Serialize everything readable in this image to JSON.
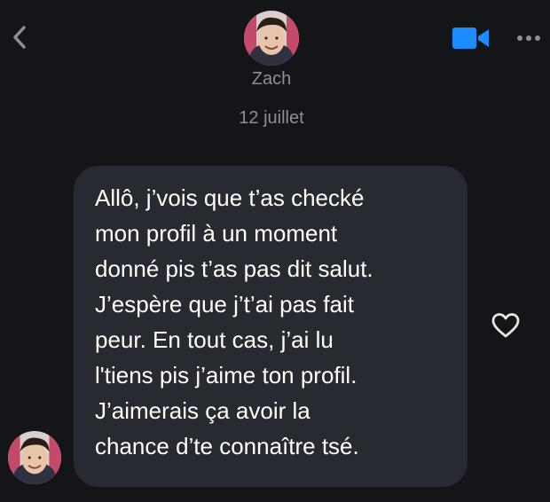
{
  "header": {
    "back_icon": "chevron-left-icon",
    "contact_name": "Zach",
    "video_icon": "video-camera-icon",
    "more_icon": "more-horizontal-icon",
    "accent_color": "#1a8cff"
  },
  "thread": {
    "date_separator": "12 juillet",
    "messages": [
      {
        "sender": "Zach",
        "lines": [
          "Allô, j’vois que t’as checké",
          "mon profil à un moment",
          "donné pis t’as pas dit salut.",
          "J’espère que j’t’ai pas fait",
          "peur. En tout cas, j’ai lu",
          "l'tiens pis j’aime ton profil.",
          "J’aimerais ça avoir la",
          "chance d’te connaître tsé."
        ],
        "reaction_icon": "heart-outline-icon"
      }
    ]
  }
}
